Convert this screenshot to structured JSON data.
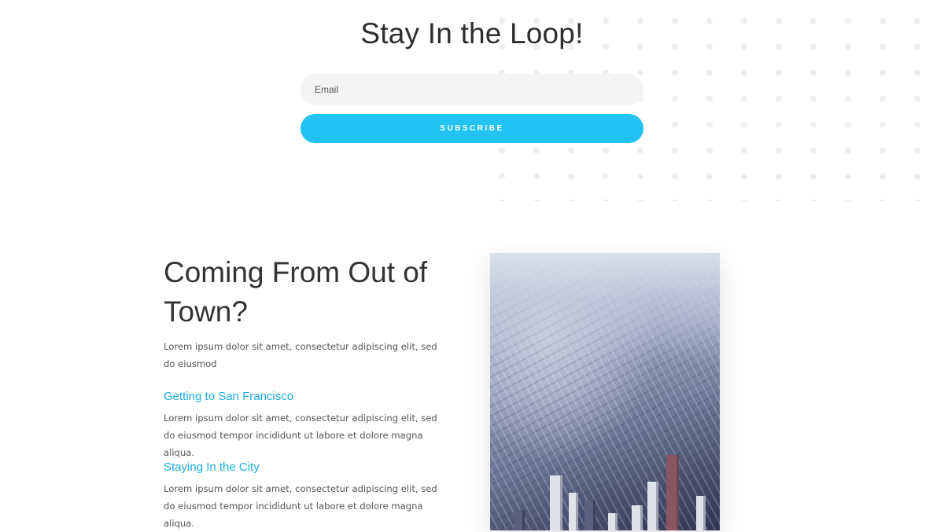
{
  "newsletter": {
    "title": "Stay In the Loop!",
    "email_placeholder": "Email",
    "email_value": "",
    "subscribe_label": "SUBSCRIBE"
  },
  "visit": {
    "heading": "Coming From Out of Town?",
    "intro": "Lorem ipsum dolor sit amet, consectetur adipiscing elit, sed do eiusmod",
    "sections": [
      {
        "title": "Getting to San Francisco",
        "body": "Lorem ipsum dolor sit amet, consectetur adipiscing elit, sed do eiusmod tempor incididunt ut labore et dolore magna aliqua."
      },
      {
        "title": "Staying In the City",
        "body": "Lorem ipsum dolor sit amet, consectetur adipiscing elit, sed do eiusmod tempor incididunt ut labore et dolore magna aliqua."
      }
    ]
  },
  "colors": {
    "accent": "#22c2f2",
    "link": "#1aaee0",
    "heading": "#333333",
    "body_text": "#555555",
    "input_bg": "#f4f4f4"
  },
  "image": {
    "subject": "aerial-city-photo"
  }
}
